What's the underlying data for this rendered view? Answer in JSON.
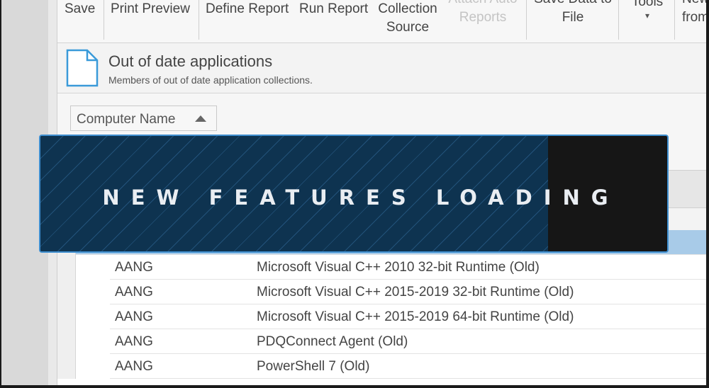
{
  "toolbar": {
    "save": "Save",
    "print_preview": "Print Preview",
    "define_report": "Define Report",
    "run_report": "Run Report",
    "collection_source_line1": "Collection",
    "collection_source_line2": "Source",
    "attach_auto_line1": "Attach Auto",
    "attach_auto_line2": "Reports",
    "save_data_line1": "Save Data to",
    "save_data_line2": "File",
    "tools": "Tools",
    "new_from_line1": "New",
    "new_from_line2": "from"
  },
  "report": {
    "icon": "document-icon",
    "title": "Out of date applications",
    "description": "Members of out of date application collections."
  },
  "sort": {
    "label": "Computer Name",
    "direction_icon": "sort-ascending-icon"
  },
  "rows": [
    {
      "computer": "",
      "application": "",
      "selected": true
    },
    {
      "computer": "AANG",
      "application": "Microsoft Visual C++ 2010 32-bit Runtime (Old)"
    },
    {
      "computer": "AANG",
      "application": "Microsoft Visual C++ 2015-2019 32-bit Runtime (Old)"
    },
    {
      "computer": "AANG",
      "application": "Microsoft Visual C++ 2015-2019 64-bit Runtime (Old)"
    },
    {
      "computer": "AANG",
      "application": "PDQConnect Agent (Old)"
    },
    {
      "computer": "AANG",
      "application": "PowerShell 7 (Old)"
    }
  ],
  "banner": {
    "text": "NEW FEATURES LOADING",
    "progress": 0.81
  },
  "colors": {
    "banner_fill": "#0e3350",
    "banner_border": "#3f8fd0",
    "selected_row": "#a8cbe8"
  }
}
